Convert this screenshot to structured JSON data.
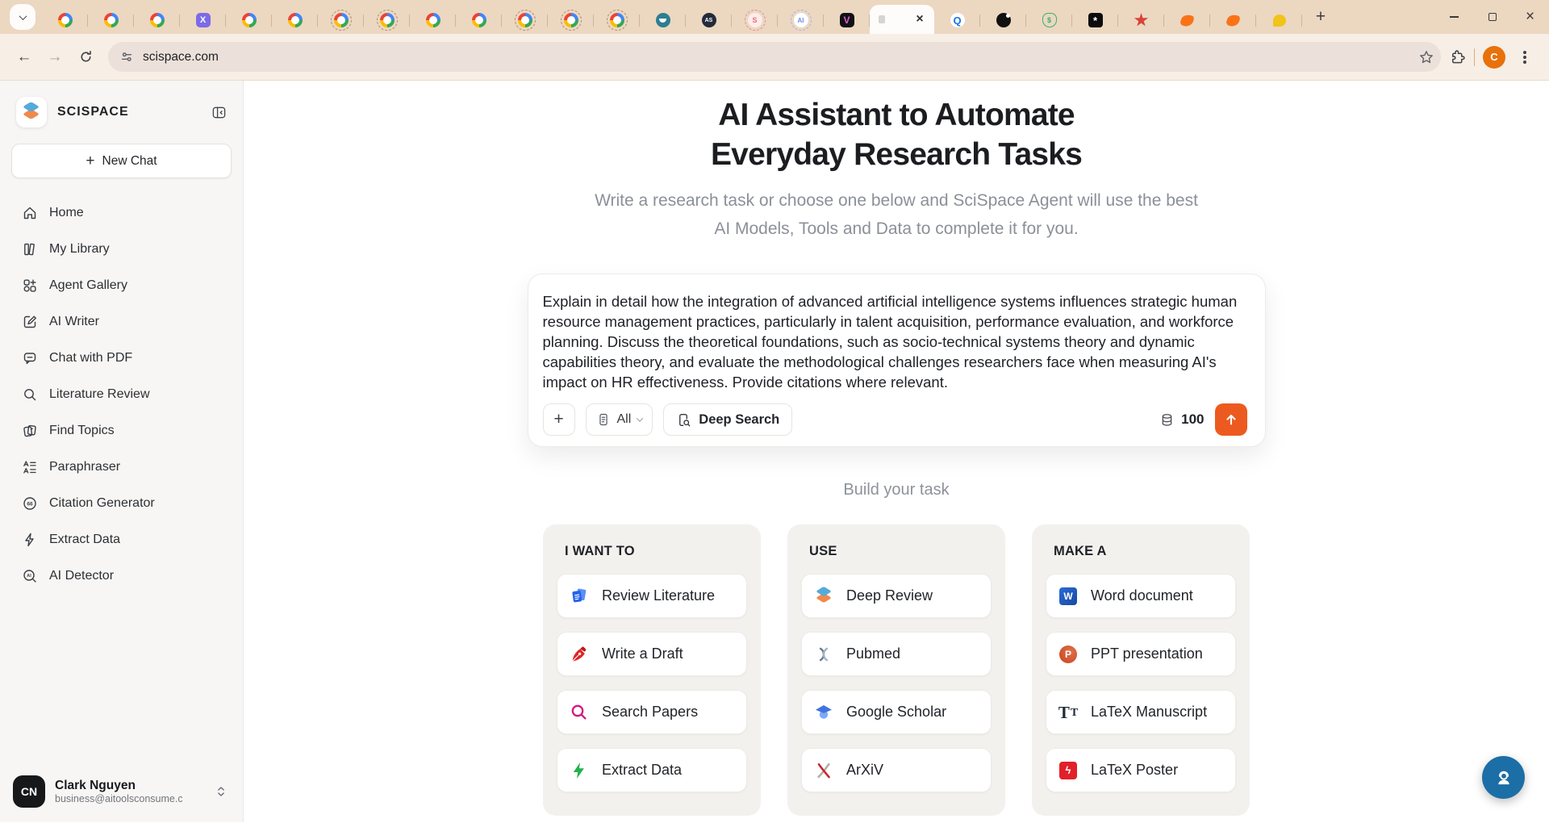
{
  "browser": {
    "url": "scispace.com",
    "tabs": [
      {
        "icon": "google"
      },
      {
        "icon": "google"
      },
      {
        "icon": "google"
      },
      {
        "icon": "axiom",
        "text": "X"
      },
      {
        "icon": "google"
      },
      {
        "icon": "google"
      },
      {
        "icon": "google-dashed"
      },
      {
        "icon": "google-dashed"
      },
      {
        "icon": "google"
      },
      {
        "icon": "google"
      },
      {
        "icon": "google-dashed"
      },
      {
        "icon": "google-dashed"
      },
      {
        "icon": "google-dashed"
      },
      {
        "icon": "teal-app"
      },
      {
        "icon": "as-app",
        "text": "AS"
      },
      {
        "icon": "pink-dashed",
        "text": "S"
      },
      {
        "icon": "ai-dashed",
        "text": "AI"
      },
      {
        "icon": "v-app",
        "text": "V"
      },
      {
        "icon": "active-scispace",
        "active": true
      },
      {
        "icon": "q-app",
        "text": "Q"
      },
      {
        "icon": "bomb-app"
      },
      {
        "icon": "moneybag-app",
        "text": "$"
      },
      {
        "icon": "pattern-app",
        "text": "*"
      },
      {
        "icon": "starburst-app"
      },
      {
        "icon": "rabbit-app"
      },
      {
        "icon": "rabbit-app"
      },
      {
        "icon": "chat-app"
      }
    ],
    "avatar_initial": "C"
  },
  "sidebar": {
    "brand": "SCISPACE",
    "new_chat_label": "New Chat",
    "items": [
      {
        "label": "Home",
        "icon": "home-icon"
      },
      {
        "label": "My Library",
        "icon": "library-icon"
      },
      {
        "label": "Agent Gallery",
        "icon": "agent-gallery-icon"
      },
      {
        "label": "AI Writer",
        "icon": "ai-writer-icon"
      },
      {
        "label": "Chat with PDF",
        "icon": "chat-with-pdf-icon"
      },
      {
        "label": "Literature Review",
        "icon": "literature-review-icon"
      },
      {
        "label": "Find Topics",
        "icon": "find-topics-icon"
      },
      {
        "label": "Paraphraser",
        "icon": "paraphraser-icon"
      },
      {
        "label": "Citation Generator",
        "icon": "citation-generator-icon"
      },
      {
        "label": "Extract Data",
        "icon": "extract-data-icon"
      },
      {
        "label": "AI Detector",
        "icon": "ai-detector-icon"
      }
    ],
    "profile": {
      "initials": "CN",
      "name": "Clark Nguyen",
      "email": "business@aitoolsconsume.c"
    }
  },
  "main": {
    "title_line1": "AI Assistant to Automate",
    "title_line2": "Everyday Research Tasks",
    "subtitle_line1": "Write a research task or choose one below and SciSpace Agent will use the best",
    "subtitle_line2": "AI Models, Tools and Data to complete it for you.",
    "prompt": {
      "text": "Explain in detail how the integration of advanced artificial intelligence systems influences strategic human resource management practices, particularly in talent acquisition, performance evaluation, and workforce planning. Discuss the theoretical foundations, such as socio-technical systems theory and dynamic capabilities theory, and evaluate the methodological challenges researchers face when measuring AI's impact on HR effectiveness. Provide citations where relevant.",
      "all_label": "All",
      "deep_search_label": "Deep Search",
      "credits": "100"
    },
    "build_your_task_label": "Build your task",
    "columns": [
      {
        "header": "I WANT TO",
        "items": [
          {
            "label": "Review Literature",
            "icon": "review-literature-icon"
          },
          {
            "label": "Write a Draft",
            "icon": "write-draft-icon"
          },
          {
            "label": "Search Papers",
            "icon": "search-papers-icon"
          },
          {
            "label": "Extract Data",
            "icon": "extract-data-bolt-icon"
          }
        ]
      },
      {
        "header": "USE",
        "items": [
          {
            "label": "Deep Review",
            "icon": "deep-review-icon"
          },
          {
            "label": "Pubmed",
            "icon": "pubmed-icon"
          },
          {
            "label": "Google Scholar",
            "icon": "google-scholar-icon"
          },
          {
            "label": "ArXiV",
            "icon": "arxiv-icon"
          }
        ]
      },
      {
        "header": "MAKE A",
        "items": [
          {
            "label": "Word document",
            "icon": "word-icon"
          },
          {
            "label": "PPT presentation",
            "icon": "ppt-icon"
          },
          {
            "label": "LaTeX Manuscript",
            "icon": "latex-manuscript-icon"
          },
          {
            "label": "LaTeX Poster",
            "icon": "latex-poster-icon"
          }
        ]
      }
    ]
  },
  "colors": {
    "accent_orange": "#ed5a20",
    "fab_blue": "#1c6ea6",
    "tabstrip_bg": "#ecd7c1",
    "toolbar_bg": "#f7eee6",
    "sidebar_bg": "#f7f6f4"
  }
}
